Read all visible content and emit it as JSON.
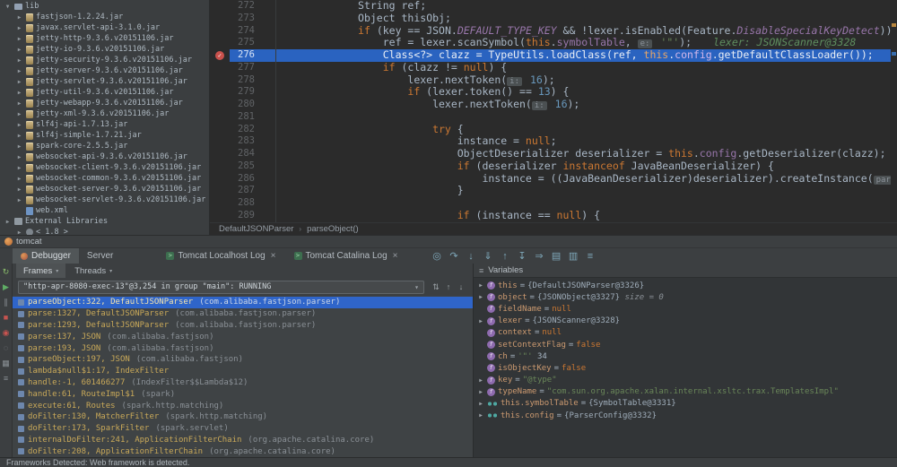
{
  "theme": {
    "exec-line": "#2a63c0",
    "selection": "#2f65ca",
    "bp-red": "#c9514c"
  },
  "glyphs": {
    "caret_down": "▾",
    "chevron_right": "▶",
    "chevron_down": "▼",
    "crumb_sep": "›",
    "check": "✓",
    "close": "×",
    "console": ">"
  },
  "project_tree": {
    "items": [
      {
        "type": "folder",
        "label": "lib",
        "indent": 0,
        "arrow": "down"
      },
      {
        "type": "jar",
        "label": "fastjson-1.2.24.jar",
        "indent": 1,
        "arrow": "right"
      },
      {
        "type": "jar",
        "label": "javax.servlet-api-3.1.0.jar",
        "indent": 1,
        "arrow": "right"
      },
      {
        "type": "jar",
        "label": "jetty-http-9.3.6.v20151106.jar",
        "indent": 1,
        "arrow": "right"
      },
      {
        "type": "jar",
        "label": "jetty-io-9.3.6.v20151106.jar",
        "indent": 1,
        "arrow": "right"
      },
      {
        "type": "jar",
        "label": "jetty-security-9.3.6.v20151106.jar",
        "indent": 1,
        "arrow": "right"
      },
      {
        "type": "jar",
        "label": "jetty-server-9.3.6.v20151106.jar",
        "indent": 1,
        "arrow": "right"
      },
      {
        "type": "jar",
        "label": "jetty-servlet-9.3.6.v20151106.jar",
        "indent": 1,
        "arrow": "right"
      },
      {
        "type": "jar",
        "label": "jetty-util-9.3.6.v20151106.jar",
        "indent": 1,
        "arrow": "right"
      },
      {
        "type": "jar",
        "label": "jetty-webapp-9.3.6.v20151106.jar",
        "indent": 1,
        "arrow": "right"
      },
      {
        "type": "jar",
        "label": "jetty-xml-9.3.6.v20151106.jar",
        "indent": 1,
        "arrow": "right"
      },
      {
        "type": "jar",
        "label": "slf4j-api-1.7.13.jar",
        "indent": 1,
        "arrow": "right"
      },
      {
        "type": "jar",
        "label": "slf4j-simple-1.7.21.jar",
        "indent": 1,
        "arrow": "right"
      },
      {
        "type": "jar",
        "label": "spark-core-2.5.5.jar",
        "indent": 1,
        "arrow": "right"
      },
      {
        "type": "jar",
        "label": "websocket-api-9.3.6.v20151106.jar",
        "indent": 1,
        "arrow": "right"
      },
      {
        "type": "jar",
        "label": "websocket-client-9.3.6.v20151106.jar",
        "indent": 1,
        "arrow": "right"
      },
      {
        "type": "jar",
        "label": "websocket-common-9.3.6.v20151106.jar",
        "indent": 1,
        "arrow": "right"
      },
      {
        "type": "jar",
        "label": "websocket-server-9.3.6.v20151106.jar",
        "indent": 1,
        "arrow": "right"
      },
      {
        "type": "jar",
        "label": "websocket-servlet-9.3.6.v20151106.jar",
        "indent": 1,
        "arrow": "right"
      },
      {
        "type": "xml",
        "label": "web.xml",
        "indent": 1,
        "arrow": "none"
      },
      {
        "type": "extlib",
        "label": "External Libraries",
        "indent": 0,
        "arrow": "right"
      },
      {
        "type": "jdk",
        "label": "< 1.8 >",
        "indent": 1,
        "arrow": "right"
      }
    ]
  },
  "editor": {
    "breadcrumbs": [
      "DefaultJSONParser",
      "parseObject()"
    ],
    "lines": [
      {
        "num": "272",
        "indent": 12,
        "tokens": [
          [
            "d",
            "String ref;"
          ]
        ]
      },
      {
        "num": "273",
        "indent": 12,
        "tokens": [
          [
            "d",
            "Object thisObj;"
          ]
        ]
      },
      {
        "num": "274",
        "indent": 12,
        "tokens": [
          [
            "k",
            "if "
          ],
          [
            "d",
            "(key == JSON."
          ],
          [
            "sf",
            "DEFAULT_TYPE_KEY"
          ],
          [
            "d",
            " && !lexer.isEnabled(Feature."
          ],
          [
            "sf",
            "DisableSpecialKeyDetect"
          ],
          [
            "d",
            ")) {"
          ]
        ]
      },
      {
        "num": "275",
        "indent": 16,
        "tokens": [
          [
            "d",
            "ref = lexer.scanSymbol("
          ],
          [
            "k",
            "this"
          ],
          [
            "d",
            "."
          ],
          [
            "f",
            "symbolTable"
          ],
          [
            "d",
            ", "
          ],
          [
            "h",
            "e:"
          ],
          [
            "d",
            " "
          ],
          [
            "s",
            "'\"'"
          ],
          [
            "d",
            ");"
          ]
        ],
        "hint": "lexer: JSONScanner@3328"
      },
      {
        "num": "276",
        "indent": 16,
        "exec": true,
        "bp": true,
        "tokens": [
          [
            "d",
            "Class<?> clazz = TypeUtils.loadClass(ref, "
          ],
          [
            "k",
            "this"
          ],
          [
            "d",
            "."
          ],
          [
            "f",
            "config"
          ],
          [
            "d",
            ".getDefaultClassLoader());"
          ]
        ]
      },
      {
        "num": "277",
        "indent": 16,
        "tokens": [
          [
            "k",
            "if"
          ],
          [
            "d",
            " (clazz != "
          ],
          [
            "k",
            "null"
          ],
          [
            "d",
            ") {"
          ]
        ]
      },
      {
        "num": "278",
        "indent": 20,
        "tokens": [
          [
            "d",
            "lexer.nextToken("
          ],
          [
            "h",
            "i:"
          ],
          [
            "d",
            " "
          ],
          [
            "n",
            "16"
          ],
          [
            "d",
            ");"
          ]
        ]
      },
      {
        "num": "279",
        "indent": 20,
        "tokens": [
          [
            "k",
            "if"
          ],
          [
            "d",
            " (lexer.token() == "
          ],
          [
            "n",
            "13"
          ],
          [
            "d",
            ") {"
          ]
        ]
      },
      {
        "num": "280",
        "indent": 24,
        "tokens": [
          [
            "d",
            "lexer.nextToken("
          ],
          [
            "h",
            "i:"
          ],
          [
            "d",
            " "
          ],
          [
            "n",
            "16"
          ],
          [
            "d",
            ");"
          ]
        ]
      },
      {
        "num": "281",
        "indent": 0,
        "tokens": []
      },
      {
        "num": "282",
        "indent": 24,
        "tokens": [
          [
            "k",
            "try"
          ],
          [
            "d",
            " {"
          ]
        ]
      },
      {
        "num": "283",
        "indent": 28,
        "tokens": [
          [
            "d",
            "instance = "
          ],
          [
            "k",
            "null"
          ],
          [
            "d",
            ";"
          ]
        ]
      },
      {
        "num": "284",
        "indent": 28,
        "tokens": [
          [
            "d",
            "ObjectDeserializer deserializer = "
          ],
          [
            "k",
            "this"
          ],
          [
            "d",
            "."
          ],
          [
            "f",
            "config"
          ],
          [
            "d",
            ".getDeserializer(clazz);"
          ]
        ]
      },
      {
        "num": "285",
        "indent": 28,
        "tokens": [
          [
            "k",
            "if"
          ],
          [
            "d",
            " (deserializer "
          ],
          [
            "k",
            "instanceof"
          ],
          [
            "d",
            " JavaBeanDeserializer) {"
          ]
        ]
      },
      {
        "num": "286",
        "indent": 32,
        "tokens": [
          [
            "d",
            "instance = ((JavaBeanDeserializer)deserializer).createInstance("
          ],
          [
            "h",
            "parser:"
          ]
        ]
      },
      {
        "num": "287",
        "indent": 28,
        "tokens": [
          [
            "d",
            "}"
          ]
        ]
      },
      {
        "num": "288",
        "indent": 0,
        "tokens": []
      },
      {
        "num": "289",
        "indent": 28,
        "tokens": [
          [
            "k",
            "if"
          ],
          [
            "d",
            " (instance == "
          ],
          [
            "k",
            "null"
          ],
          [
            "d",
            ") {"
          ]
        ]
      }
    ]
  },
  "session": {
    "label": "tomcat"
  },
  "debug_toolbar": {
    "tabs": [
      {
        "label": "Debugger",
        "icon": "bug-icon",
        "active": true
      },
      {
        "label": "Server",
        "icon": null,
        "active": false
      }
    ],
    "log_tabs": [
      {
        "label": "Tomcat Localhost Log"
      },
      {
        "label": "Tomcat Catalina Log"
      }
    ],
    "step_icons": [
      {
        "name": "show-execution-point-icon",
        "glyph": "◎"
      },
      {
        "name": "step-over-icon",
        "glyph": "↷"
      },
      {
        "name": "step-into-icon",
        "glyph": "↓"
      },
      {
        "name": "force-step-into-icon",
        "glyph": "⇓"
      },
      {
        "name": "step-out-icon",
        "glyph": "↑"
      },
      {
        "name": "drop-frame-icon",
        "glyph": "↧"
      },
      {
        "name": "run-to-cursor-icon",
        "glyph": "⇒"
      },
      {
        "name": "evaluate-expression-icon",
        "glyph": "▤"
      },
      {
        "name": "layout-icon",
        "glyph": "▥"
      },
      {
        "name": "settings-icon",
        "glyph": "≡"
      }
    ]
  },
  "debug_side_toolbar": {
    "icons": [
      {
        "name": "rerun-icon",
        "glyph": "↻",
        "color": "#8abe6a"
      },
      {
        "name": "resume-icon",
        "glyph": "▶",
        "color": "#5fad65"
      },
      {
        "name": "pause-icon",
        "glyph": "∥",
        "color": "#8a9095"
      },
      {
        "name": "stop-icon",
        "glyph": "■",
        "color": "#c75450"
      },
      {
        "name": "view-breakpoints-icon",
        "glyph": "◉",
        "color": "#c75450"
      },
      {
        "name": "mute-breakpoints-icon",
        "glyph": "◌",
        "color": "#8a9095"
      },
      {
        "name": "restore-layout-icon",
        "glyph": "▦",
        "color": "#8a9095"
      },
      {
        "name": "pin-icon",
        "glyph": "≡",
        "color": "#8a9095"
      }
    ]
  },
  "frames_panel": {
    "tabs": [
      {
        "label": "Frames",
        "active": true
      },
      {
        "label": "Threads",
        "active": false
      }
    ],
    "thread_selector": "\"http-apr-8080-exec-13\"@3,254 in group \"main\": RUNNING",
    "toolbar_icons": [
      {
        "name": "filter-icon",
        "glyph": "⇅"
      },
      {
        "name": "prev-frame-icon",
        "glyph": "↑"
      },
      {
        "name": "next-frame-icon",
        "glyph": "↓"
      }
    ],
    "frames": [
      {
        "text": "parseObject:322, DefaultJSONParser",
        "pkg": "(com.alibaba.fastjson.parser)",
        "selected": true
      },
      {
        "text": "parse:1327, DefaultJSONParser",
        "pkg": "(com.alibaba.fastjson.parser)",
        "selected": false
      },
      {
        "text": "parse:1293, DefaultJSONParser",
        "pkg": "(com.alibaba.fastjson.parser)",
        "selected": false
      },
      {
        "text": "parse:137, JSON",
        "pkg": "(com.alibaba.fastjson)",
        "selected": false
      },
      {
        "text": "parse:193, JSON",
        "pkg": "(com.alibaba.fastjson)",
        "selected": false
      },
      {
        "text": "parseObject:197, JSON",
        "pkg": "(com.alibaba.fastjson)",
        "selected": false
      },
      {
        "text": "lambda$null$1:17, IndexFilter",
        "pkg": "",
        "selected": false
      },
      {
        "text": "handle:-1, 601466277",
        "pkg": "(IndexFilter$$Lambda$12)",
        "selected": false
      },
      {
        "text": "handle:61, RouteImpl$1",
        "pkg": "(spark)",
        "selected": false
      },
      {
        "text": "execute:61, Routes",
        "pkg": "(spark.http.matching)",
        "selected": false
      },
      {
        "text": "doFilter:130, MatcherFilter",
        "pkg": "(spark.http.matching)",
        "selected": false
      },
      {
        "text": "doFilter:173, SparkFilter",
        "pkg": "(spark.servlet)",
        "selected": false
      },
      {
        "text": "internalDoFilter:241, ApplicationFilterChain",
        "pkg": "(org.apache.catalina.core)",
        "selected": false
      },
      {
        "text": "doFilter:208, ApplicationFilterChain",
        "pkg": "(org.apache.catalina.core)",
        "selected": false
      }
    ]
  },
  "variables_panel": {
    "title": "Variables",
    "variables": [
      {
        "expand": true,
        "icon": "field",
        "name": "this",
        "value": [
          [
            "ref",
            "{DefaultJSONParser@3326}"
          ]
        ]
      },
      {
        "expand": true,
        "icon": "field",
        "name": "object",
        "value": [
          [
            "ref",
            "{JSONObject@3327}"
          ],
          [
            "dim",
            " size = 0"
          ]
        ]
      },
      {
        "expand": false,
        "icon": "field",
        "name": "fieldName",
        "value": [
          [
            "kw",
            "null"
          ]
        ]
      },
      {
        "expand": true,
        "icon": "field",
        "name": "lexer",
        "value": [
          [
            "ref",
            "{JSONScanner@3328}"
          ]
        ]
      },
      {
        "expand": false,
        "icon": "field",
        "name": "context",
        "value": [
          [
            "kw",
            "null"
          ]
        ]
      },
      {
        "expand": false,
        "icon": "field",
        "name": "setContextFlag",
        "value": [
          [
            "kw",
            "false"
          ]
        ]
      },
      {
        "expand": false,
        "icon": "field",
        "name": "ch",
        "value": [
          [
            "str",
            "'\"'"
          ],
          [
            "d",
            " 34"
          ]
        ]
      },
      {
        "expand": false,
        "icon": "field",
        "name": "isObjectKey",
        "value": [
          [
            "kw",
            "false"
          ]
        ]
      },
      {
        "expand": true,
        "icon": "field",
        "name": "key",
        "value": [
          [
            "str",
            "\"@type\""
          ]
        ]
      },
      {
        "expand": true,
        "icon": "field",
        "name": "typeName",
        "value": [
          [
            "str",
            "\"com.sun.org.apache.xalan.internal.xsltc.trax.TemplatesImpl\""
          ]
        ]
      },
      {
        "expand": true,
        "icon": "watch",
        "name": "this.symbolTable",
        "value": [
          [
            "ref",
            "{SymbolTable@3331}"
          ]
        ]
      },
      {
        "expand": true,
        "icon": "watch",
        "name": "this.config",
        "value": [
          [
            "ref",
            "{ParserConfig@3332}"
          ]
        ]
      }
    ]
  },
  "status_bar": {
    "text": "Frameworks Detected: Web framework is detected."
  }
}
